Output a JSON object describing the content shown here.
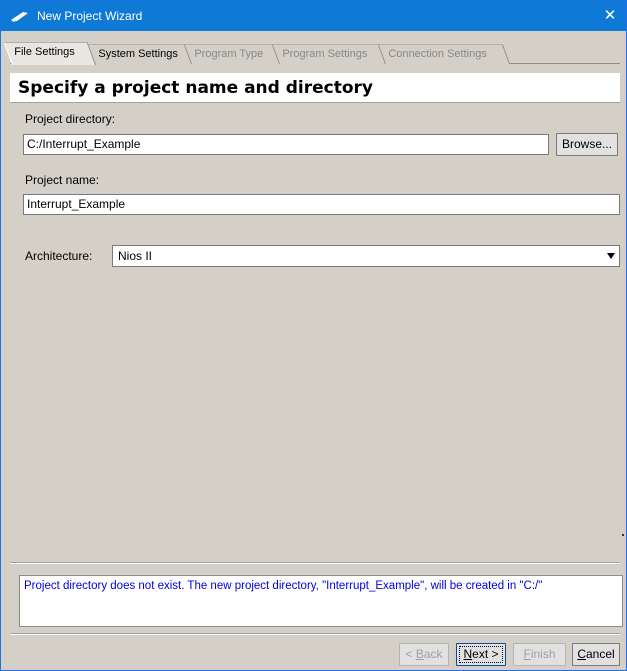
{
  "window": {
    "title": "New Project Wizard",
    "close_glyph": "✕",
    "title_icon": "wizard-pen-icon"
  },
  "tabs": [
    {
      "label": "File Settings",
      "state": "active"
    },
    {
      "label": "System Settings",
      "state": "enabled"
    },
    {
      "label": "Program Type",
      "state": "disabled"
    },
    {
      "label": "Program Settings",
      "state": "disabled"
    },
    {
      "label": "Connection Settings",
      "state": "disabled"
    }
  ],
  "heading": "Specify a project name and directory",
  "form": {
    "project_directory_label": "Project directory:",
    "project_directory_value": "C:/Interrupt_Example",
    "browse_label": "Browse...",
    "project_name_label": "Project name:",
    "project_name_value": "Interrupt_Example",
    "architecture_label": "Architecture:",
    "architecture_value": "Nios II"
  },
  "message": "Project directory does not exist. The new project directory, \"Interrupt_Example\", will be created in \"C:/\"",
  "buttons": {
    "back_prefix": "< ",
    "back_mnemonic": "B",
    "back_rest": "ack",
    "next_mnemonic": "N",
    "next_rest": "ext >",
    "finish_mnemonic": "F",
    "finish_rest": "inish",
    "cancel_mnemonic": "C",
    "cancel_rest": "ancel"
  },
  "colors": {
    "titlebar": "#0e7ad6",
    "dialog_bg": "#d4d0c8",
    "message_text": "#0000e0"
  }
}
